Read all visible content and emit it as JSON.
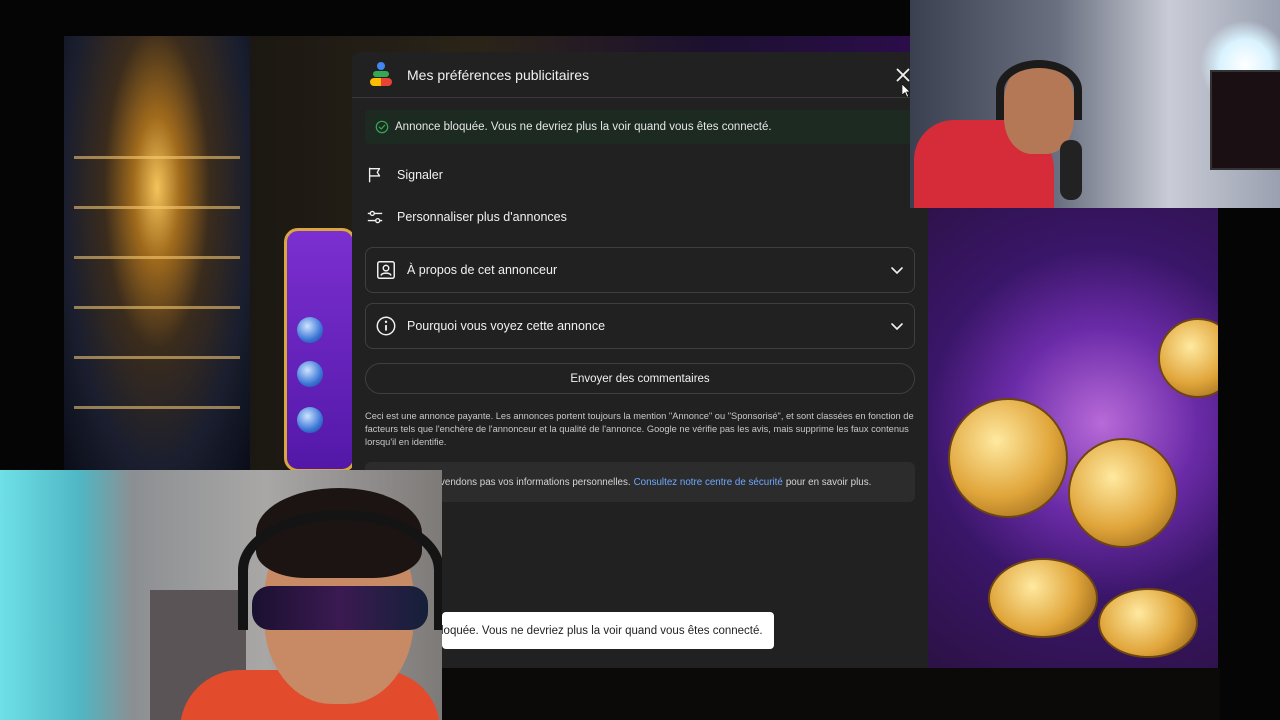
{
  "panel": {
    "title": "Mes préférences publicitaires",
    "close_icon": "close-icon",
    "notice": "Annonce bloquée. Vous ne devriez plus la voir quand vous êtes connecté.",
    "report_label": "Signaler",
    "customize_label": "Personnaliser plus d'annonces",
    "about_advertiser_label": "À propos de cet annonceur",
    "why_ad_label": "Pourquoi vous voyez cette annonce",
    "feedback_label": "Envoyer des commentaires",
    "disclaimer": "Ceci est une annonce payante. Les annonces portent toujours la mention \"Annonce\" ou \"Sponsorisé\", et sont classées en fonction de facteurs tels que l'enchère de l'annonceur et la qualité de l'annonce. Google ne vérifie pas les avis, mais supprime les faux contenus lorsqu'il en identifie.",
    "privacy_prefix": "vendons pas vos informations personnelles.",
    "privacy_link": "Consultez notre centre de sécurité",
    "privacy_suffix": "pour en savoir plus."
  },
  "toast": {
    "text": "loquée. Vous ne devriez plus la voir quand vous êtes connecté."
  },
  "colors": {
    "panel_bg": "#212121",
    "notice_bg": "#1d2a22",
    "link": "#6fa8ff",
    "success": "#34a853"
  }
}
